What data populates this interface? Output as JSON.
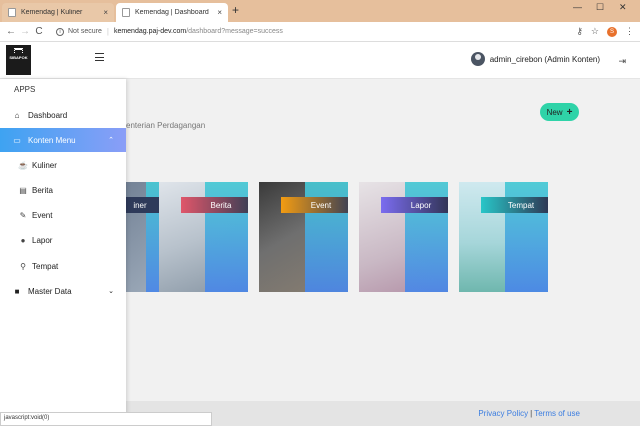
{
  "browser": {
    "tabs": [
      {
        "title": "Kemendag | Kuliner",
        "close": "×"
      },
      {
        "title": "Kemendag | Dashboard",
        "close": "×"
      }
    ],
    "new_tab": "+",
    "window_controls": {
      "minimize": "—",
      "maximize": "☐",
      "close": "✕"
    },
    "nav": {
      "back": "←",
      "forward": "→",
      "reload": "C"
    },
    "security_icon": "i",
    "security_text": "Not secure",
    "url_host": "kemendag.paj-dev.com",
    "url_path": "/dashboard?message=success",
    "right_icons": {
      "key": "⚷",
      "star": "☆",
      "profile": "S",
      "menu": "⋮"
    },
    "status_text": "javascript:void(0)"
  },
  "header": {
    "logo_text": "SIBAPOK",
    "user_name": "admin_cirebon (Admin Konten)",
    "logout_icon": "⇥"
  },
  "sidebar": {
    "section": "APPS",
    "items": [
      {
        "label": "Dashboard",
        "icon": "⌂"
      },
      {
        "label": "Konten Menu",
        "icon": "▭",
        "chevron": "⌃"
      },
      {
        "label": "Kuliner",
        "icon": "☕"
      },
      {
        "label": "Berita",
        "icon": "▤"
      },
      {
        "label": "Event",
        "icon": "✎"
      },
      {
        "label": "Lapor",
        "icon": "●"
      },
      {
        "label": "Tempat",
        "icon": "⚲"
      },
      {
        "label": "Master Data",
        "icon": "■",
        "chevron": "⌄"
      }
    ]
  },
  "main": {
    "subtitle": "enterian Perdagangan",
    "new_button": {
      "label": "New",
      "icon": "+"
    },
    "cards": [
      {
        "label": "iner",
        "ribbon_color": "#2e3a5a"
      },
      {
        "label": "Berita",
        "ribbon_color": "#e0566a"
      },
      {
        "label": "Event",
        "ribbon_color": "#f39c12"
      },
      {
        "label": "Lapor",
        "ribbon_color": "#7b6cf0"
      },
      {
        "label": "Tempat",
        "ribbon_color": "#28c6c8"
      }
    ]
  },
  "footer": {
    "privacy": "Privacy Policy",
    "divider": "|",
    "terms": "Terms of use"
  }
}
